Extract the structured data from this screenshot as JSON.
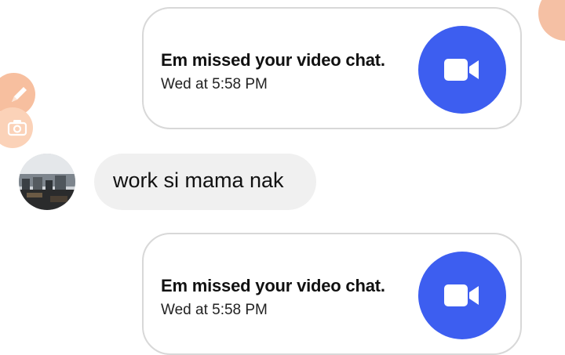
{
  "messages": [
    {
      "type": "missed-video-call",
      "title": "Em missed your video chat.",
      "time": "Wed at 5:58 PM"
    },
    {
      "type": "incoming-text",
      "text": "work si mama nak"
    },
    {
      "type": "missed-video-call",
      "title": "Em missed your video chat.",
      "time": "Wed at 5:58 PM"
    }
  ],
  "icons": {
    "call": "video-camera-icon",
    "floating": [
      "pencil-icon",
      "camera-icon",
      "floating-bubble"
    ]
  },
  "colors": {
    "call_icon_bg": "#3d5ef0",
    "incoming_bubble_bg": "#f0f0f0",
    "card_border": "#d8d8d8",
    "floating_button": "#f7bf9f"
  }
}
